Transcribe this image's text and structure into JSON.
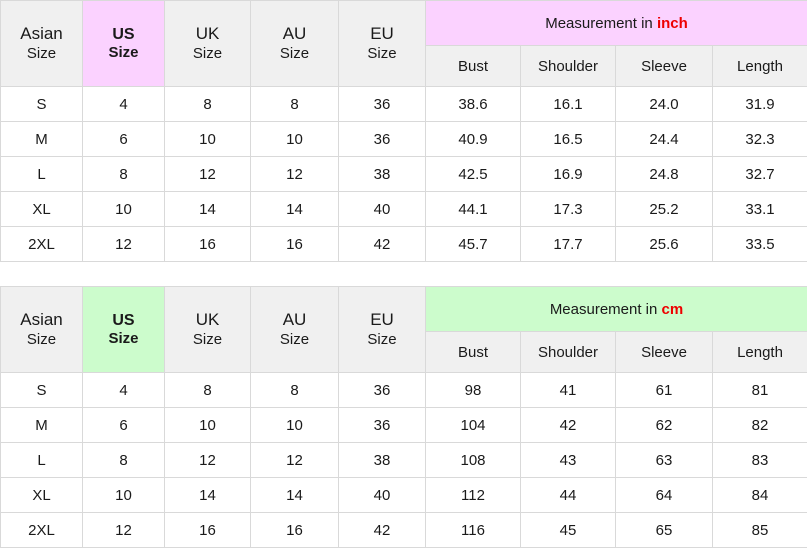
{
  "tables": [
    {
      "id": "inch-table",
      "accent_color": "#fbd2ff",
      "unit_color": "#ee0000",
      "size_headers": [
        {
          "line1": "Asian",
          "line2": "Size"
        },
        {
          "line1": "US",
          "line2": "Size"
        },
        {
          "line1": "UK",
          "line2": "Size"
        },
        {
          "line1": "AU",
          "line2": "Size"
        },
        {
          "line1": "EU",
          "line2": "Size"
        }
      ],
      "measurement_title_prefix": "Measurement in ",
      "measurement_unit": "inch",
      "measurement_headers": [
        "Bust",
        "Shoulder",
        "Sleeve",
        "Length"
      ],
      "rows": [
        {
          "asian": "S",
          "us": "4",
          "uk": "8",
          "au": "8",
          "eu": "36",
          "bust": "38.6",
          "shoulder": "16.1",
          "sleeve": "24.0",
          "length": "31.9"
        },
        {
          "asian": "M",
          "us": "6",
          "uk": "10",
          "au": "10",
          "eu": "36",
          "bust": "40.9",
          "shoulder": "16.5",
          "sleeve": "24.4",
          "length": "32.3"
        },
        {
          "asian": "L",
          "us": "8",
          "uk": "12",
          "au": "12",
          "eu": "38",
          "bust": "42.5",
          "shoulder": "16.9",
          "sleeve": "24.8",
          "length": "32.7"
        },
        {
          "asian": "XL",
          "us": "10",
          "uk": "14",
          "au": "14",
          "eu": "40",
          "bust": "44.1",
          "shoulder": "17.3",
          "sleeve": "25.2",
          "length": "33.1"
        },
        {
          "asian": "2XL",
          "us": "12",
          "uk": "16",
          "au": "16",
          "eu": "42",
          "bust": "45.7",
          "shoulder": "17.7",
          "sleeve": "25.6",
          "length": "33.5"
        }
      ]
    },
    {
      "id": "cm-table",
      "accent_color": "#ccfccc",
      "unit_color": "#ee0000",
      "size_headers": [
        {
          "line1": "Asian",
          "line2": "Size"
        },
        {
          "line1": "US",
          "line2": "Size"
        },
        {
          "line1": "UK",
          "line2": "Size"
        },
        {
          "line1": "AU",
          "line2": "Size"
        },
        {
          "line1": "EU",
          "line2": "Size"
        }
      ],
      "measurement_title_prefix": "Measurement in ",
      "measurement_unit": "cm",
      "measurement_headers": [
        "Bust",
        "Shoulder",
        "Sleeve",
        "Length"
      ],
      "rows": [
        {
          "asian": "S",
          "us": "4",
          "uk": "8",
          "au": "8",
          "eu": "36",
          "bust": "98",
          "shoulder": "41",
          "sleeve": "61",
          "length": "81"
        },
        {
          "asian": "M",
          "us": "6",
          "uk": "10",
          "au": "10",
          "eu": "36",
          "bust": "104",
          "shoulder": "42",
          "sleeve": "62",
          "length": "82"
        },
        {
          "asian": "L",
          "us": "8",
          "uk": "12",
          "au": "12",
          "eu": "38",
          "bust": "108",
          "shoulder": "43",
          "sleeve": "63",
          "length": "83"
        },
        {
          "asian": "XL",
          "us": "10",
          "uk": "14",
          "au": "14",
          "eu": "40",
          "bust": "112",
          "shoulder": "44",
          "sleeve": "64",
          "length": "84"
        },
        {
          "asian": "2XL",
          "us": "12",
          "uk": "16",
          "au": "16",
          "eu": "42",
          "bust": "116",
          "shoulder": "45",
          "sleeve": "65",
          "length": "85"
        }
      ]
    }
  ]
}
